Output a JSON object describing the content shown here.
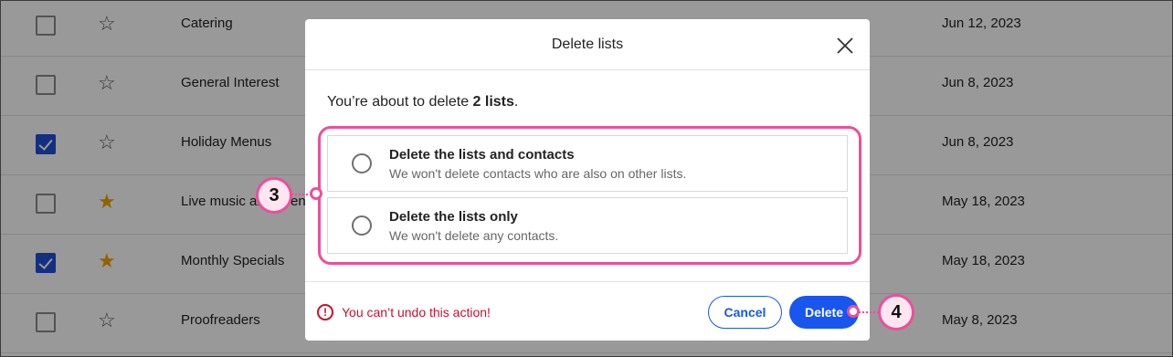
{
  "background_table": {
    "rows": [
      {
        "name": "Catering",
        "date": "Jun 12, 2023",
        "checked": false,
        "starred": false
      },
      {
        "name": "General Interest",
        "date": "Jun 8, 2023",
        "checked": false,
        "starred": false
      },
      {
        "name": "Holiday Menus",
        "date": "Jun 8, 2023",
        "checked": true,
        "starred": false
      },
      {
        "name": "Live music and events",
        "date": "May 18, 2023",
        "checked": false,
        "starred": true
      },
      {
        "name": "Monthly Specials",
        "date": "May 18, 2023",
        "checked": true,
        "starred": true
      },
      {
        "name": "Proofreaders",
        "date": "May 8, 2023",
        "checked": false,
        "starred": false
      }
    ]
  },
  "dialog": {
    "title": "Delete lists",
    "intro_prefix": "You’re about to delete ",
    "intro_count": "2 lists",
    "intro_suffix": ".",
    "options": [
      {
        "title": "Delete the lists and contacts",
        "subtitle": "We won't delete contacts who are also on other lists."
      },
      {
        "title": "Delete the lists only",
        "subtitle": "We won't delete any contacts."
      }
    ],
    "warning": "You can’t undo this action!",
    "cancel_label": "Cancel",
    "delete_label": "Delete"
  },
  "callouts": {
    "options_step": "3",
    "delete_step": "4"
  },
  "colors": {
    "accent_blue": "#1856ed",
    "checkbox_blue": "#1f4fd8",
    "star_filled": "#f5a200",
    "warning_red": "#c8102e",
    "callout_pink": "#ec4f9a"
  },
  "icons": {
    "close": "close-icon",
    "warning": "alert-circle-icon",
    "star": "star-icon",
    "radio": "radio-icon"
  }
}
